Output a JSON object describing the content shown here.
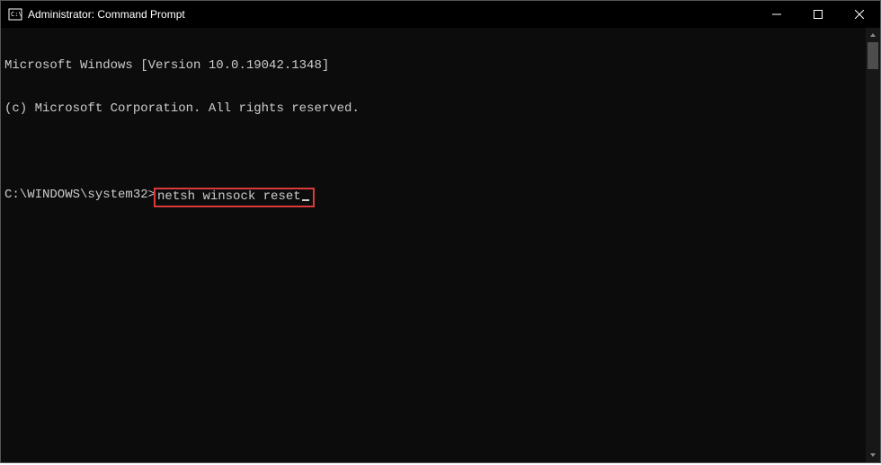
{
  "titlebar": {
    "title": "Administrator: Command Prompt"
  },
  "terminal": {
    "line1": "Microsoft Windows [Version 10.0.19042.1348]",
    "line2": "(c) Microsoft Corporation. All rights reserved.",
    "prompt": "C:\\WINDOWS\\system32>",
    "command": "netsh winsock reset"
  }
}
